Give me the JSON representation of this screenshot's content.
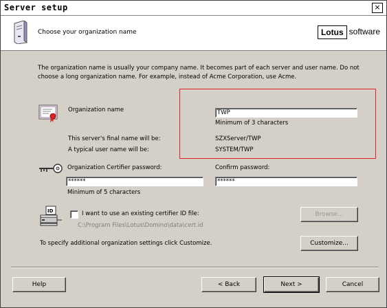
{
  "window": {
    "title": "Server setup",
    "close": "×"
  },
  "header": {
    "subtitle": "Choose your organization name",
    "logo_brand": "Lotus",
    "logo_suffix": "software"
  },
  "intro": "The organization name is usually your company name. It becomes part of each server and user name. Do not choose a long organization name. For example, instead of Acme Corporation, use Acme.",
  "org": {
    "label": "Organization name",
    "value": "TWP",
    "hint": "Minimum of 3 characters",
    "final_server_label": "This server's final name will be:",
    "final_server_value": "SZXServer/TWP",
    "typical_user_label": "A typical user name will be:",
    "typical_user_value": "SYSTEM/TWP"
  },
  "password": {
    "certifier_label": "Organization Certifier password:",
    "certifier_value": "******",
    "certifier_hint": "Minimum of 5 characters",
    "confirm_label": "Confirm password:",
    "confirm_value": "******"
  },
  "certifier_id": {
    "checkbox_label": "I want to use an existing certifier ID file:",
    "checked": false,
    "path": "C:\\Program Files\\Lotus\\Domino\\data\\cert.id",
    "browse_label": "Browse..."
  },
  "customize": {
    "text": "To specify additional organization settings click Customize.",
    "button_label": "Customize..."
  },
  "footer": {
    "help": "Help",
    "back": "< Back",
    "next": "Next >",
    "cancel": "Cancel"
  },
  "colors": {
    "highlight_box": "#e21f1f",
    "dialog_bg": "#d4d0c8"
  }
}
